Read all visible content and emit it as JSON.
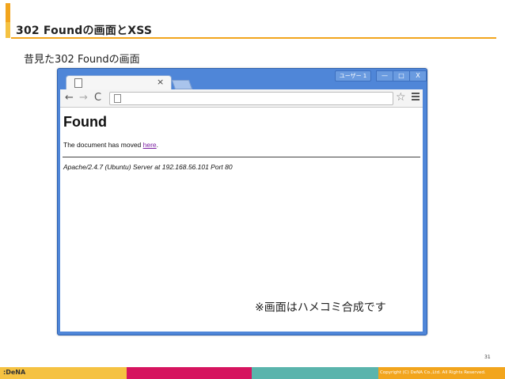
{
  "slide": {
    "title": "302 Foundの画面とXSS",
    "subtitle": "昔見た302 Foundの画面",
    "note": "※画面はハメコミ合成です",
    "page_number": "31",
    "logo": ":DeNA",
    "copyright": "Copyright (C) DeNA Co.,Ltd. All Rights Reserved."
  },
  "browser": {
    "user_button": "ユーザー 1",
    "tab_close": "×",
    "min_label": "—",
    "max_label": "□",
    "close_label": "X",
    "back": "←",
    "forward": "→",
    "reload": "C",
    "star": "☆"
  },
  "page": {
    "heading": "Found",
    "moved_prefix": "The document has moved ",
    "moved_link": "here",
    "moved_suffix": ".",
    "address": "Apache/2.4.7 (Ubuntu) Server at 192.168.56.101 Port 80"
  },
  "colors": {
    "accent": "#f2a51d",
    "window_frame": "#4f86d8",
    "link": "#7b1fa2",
    "footer_segments": [
      "#f5c242",
      "#d6145f",
      "#5ab4ac",
      "#f2a51d"
    ]
  }
}
